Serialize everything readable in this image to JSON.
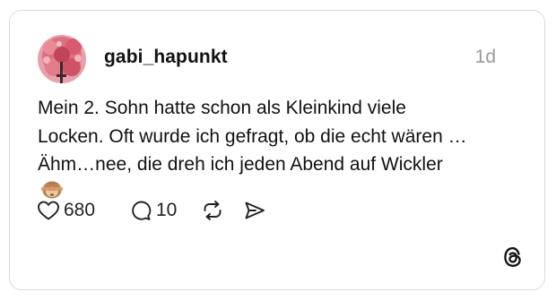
{
  "post": {
    "username": "gabi_hapunkt",
    "timestamp": "1d",
    "text_lines": [
      "Mein 2. Sohn hatte schon als Kleinkind viele",
      "Locken. Oft wurde ich gefragt, ob die echt wären …",
      "Ähm…nee, die dreh ich jeden Abend auf Wickler"
    ],
    "text_emoji": "see-no-evil-monkey"
  },
  "actions": {
    "likes": "680",
    "replies": "10",
    "repost_icon": "repost-icon",
    "share_icon": "share-icon"
  },
  "brand": {
    "logo_icon": "threads-logo-icon"
  },
  "colors": {
    "text": "#111111",
    "muted": "#9a9a9a",
    "border": "#d9d9d9",
    "avatar": "#e0707e"
  }
}
